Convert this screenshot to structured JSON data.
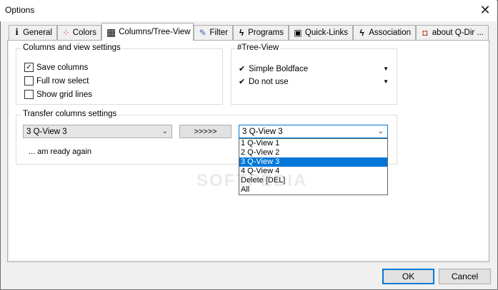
{
  "window": {
    "title": "Options",
    "close_glyph": "✕"
  },
  "tabs": [
    {
      "label": "General",
      "icon": "info-icon",
      "glyph": "i"
    },
    {
      "label": "Colors",
      "icon": "palette-icon",
      "glyph": "⁘"
    },
    {
      "label": "Columns/Tree-View",
      "icon": "grid-icon",
      "glyph": "▦"
    },
    {
      "label": "Filter",
      "icon": "filter-icon",
      "glyph": "✎"
    },
    {
      "label": "Programs",
      "icon": "lightning-icon",
      "glyph": "ϟ"
    },
    {
      "label": "Quick-Links",
      "icon": "links-icon",
      "glyph": "▣"
    },
    {
      "label": "Association",
      "icon": "association-icon",
      "glyph": "ϟ"
    },
    {
      "label": "about Q-Dir ...",
      "icon": "about-icon",
      "glyph": "◘"
    }
  ],
  "columns_group": {
    "title": "Columns and view settings",
    "items": [
      {
        "label": "Save columns",
        "checked": true
      },
      {
        "label": "Full row select",
        "checked": false
      },
      {
        "label": "Show grid lines",
        "checked": false
      }
    ]
  },
  "treeview_group": {
    "title": "#Tree-View",
    "items": [
      {
        "label": "Simple Boldface"
      },
      {
        "label": "Do not use"
      }
    ]
  },
  "transfer_group": {
    "title": "Transfer columns settings",
    "source_value": "3 Q-View 3",
    "transfer_button": ">>>>>",
    "target_value": "3 Q-View 3",
    "status_text": "... am ready again",
    "dropdown_options": [
      "1 Q-View 1",
      "2 Q-View 2",
      "3 Q-View 3",
      "4 Q-View 4",
      "Delete [DEL]",
      "All"
    ],
    "selected_option": "3 Q-View 3"
  },
  "watermark": "SOFTPEDIA",
  "footer": {
    "ok": "OK",
    "cancel": "Cancel"
  },
  "colors": {
    "accent": "#0078d7"
  }
}
